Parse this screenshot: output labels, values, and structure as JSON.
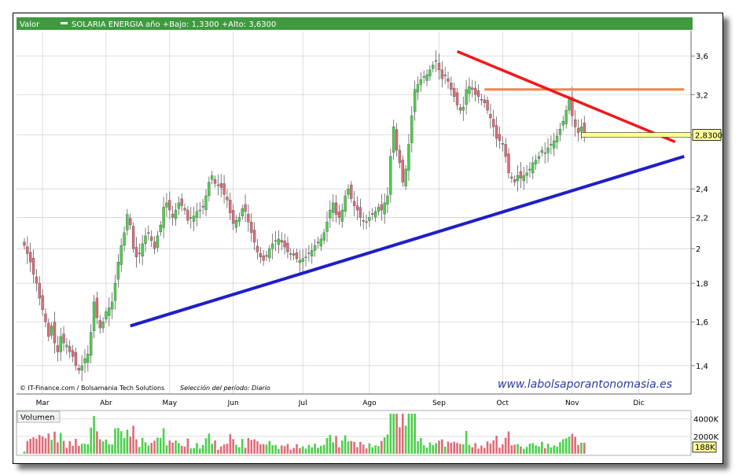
{
  "header": {
    "label": "Valor",
    "ticker": "SOLARIA ENERGIA",
    "range": "año +Bajo: 1,3300 +Alto: 3,6300"
  },
  "credits": {
    "source": "© IT-Finance.com / Bolsamania Tech Solutions",
    "period": "Selección del período: Diario"
  },
  "watermark": "www.labolsaporantonomasia.es",
  "last_price_badge": "2,8300",
  "volume_panel": {
    "label": "Volumen",
    "ticks": [
      {
        "v": 4000,
        "label": "4000K"
      },
      {
        "v": 2000,
        "label": "2000K"
      }
    ],
    "last_badge": "188K",
    "max": 4700
  },
  "colors": {
    "header_green": "#3f9a3f",
    "up": "#4cd04c",
    "down": "#e06b78",
    "grid": "#d3d3d3",
    "support_line": "#1f1fc8",
    "resistance_line": "#f0181c",
    "horizontal_level": "#f4834c",
    "badge_fill": "#ffff99",
    "watermark": "#2a3aa0"
  },
  "chart_data": {
    "type": "candlestick",
    "ylim": [
      1.29,
      3.87
    ],
    "y_scale": "log",
    "y_ticks": [
      {
        "v": 3.6,
        "label": "3,6"
      },
      {
        "v": 3.2,
        "label": "3,2"
      },
      {
        "v": 2.83,
        "label": ""
      },
      {
        "v": 2.4,
        "label": "2,4"
      },
      {
        "v": 2.2,
        "label": "2,2"
      },
      {
        "v": 2.0,
        "label": "2"
      },
      {
        "v": 1.8,
        "label": "1,8"
      },
      {
        "v": 1.6,
        "label": "1,6"
      },
      {
        "v": 1.4,
        "label": "1,4"
      }
    ],
    "months": [
      {
        "i": 6,
        "label": "Mar"
      },
      {
        "i": 27,
        "label": "Abr"
      },
      {
        "i": 48,
        "label": "May"
      },
      {
        "i": 69,
        "label": "Jun"
      },
      {
        "i": 92,
        "label": "Jul"
      },
      {
        "i": 114,
        "label": "Ago"
      },
      {
        "i": 137,
        "label": "Sep"
      },
      {
        "i": 158,
        "label": "Oct"
      },
      {
        "i": 181,
        "label": "Nov"
      },
      {
        "i": 203,
        "label": "Dic"
      }
    ],
    "closes": [
      2.02,
      1.97,
      1.92,
      1.85,
      1.8,
      1.72,
      1.66,
      1.6,
      1.53,
      1.58,
      1.5,
      1.46,
      1.53,
      1.5,
      1.49,
      1.46,
      1.44,
      1.4,
      1.38,
      1.4,
      1.43,
      1.45,
      1.55,
      1.7,
      1.62,
      1.57,
      1.6,
      1.65,
      1.67,
      1.7,
      1.8,
      1.92,
      2.02,
      2.1,
      2.22,
      2.15,
      2.0,
      1.95,
      1.97,
      2.03,
      2.08,
      2.1,
      2.05,
      2.0,
      2.08,
      2.15,
      2.27,
      2.3,
      2.25,
      2.2,
      2.25,
      2.3,
      2.28,
      2.25,
      2.18,
      2.2,
      2.21,
      2.24,
      2.25,
      2.27,
      2.35,
      2.45,
      2.5,
      2.44,
      2.43,
      2.41,
      2.36,
      2.32,
      2.23,
      2.16,
      2.18,
      2.2,
      2.26,
      2.24,
      2.17,
      2.1,
      2.04,
      1.98,
      1.95,
      1.93,
      1.96,
      2.0,
      2.03,
      2.05,
      2.06,
      2.04,
      2.01,
      1.98,
      1.97,
      1.96,
      1.94,
      1.93,
      1.94,
      1.95,
      1.97,
      1.99,
      2.02,
      2.04,
      2.06,
      2.1,
      2.17,
      2.25,
      2.3,
      2.22,
      2.2,
      2.25,
      2.35,
      2.4,
      2.33,
      2.28,
      2.25,
      2.2,
      2.18,
      2.17,
      2.2,
      2.22,
      2.24,
      2.27,
      2.25,
      2.3,
      2.35,
      2.65,
      2.9,
      2.7,
      2.6,
      2.45,
      2.55,
      2.75,
      3.0,
      3.25,
      3.3,
      3.35,
      3.38,
      3.4,
      3.45,
      3.5,
      3.55,
      3.45,
      3.36,
      3.4,
      3.33,
      3.25,
      3.18,
      3.1,
      3.05,
      3.08,
      3.25,
      3.28,
      3.25,
      3.2,
      3.18,
      3.15,
      3.12,
      3.05,
      2.98,
      2.9,
      2.8,
      2.78,
      2.75,
      2.65,
      2.52,
      2.48,
      2.45,
      2.5,
      2.48,
      2.5,
      2.52,
      2.55,
      2.6,
      2.62,
      2.65,
      2.7,
      2.68,
      2.72,
      2.75,
      2.78,
      2.82,
      2.88,
      2.95,
      3.05,
      3.15,
      3.0,
      2.9,
      2.85,
      2.9,
      2.83
    ],
    "annotations": {
      "support": {
        "from": [
          35,
          1.58
        ],
        "to": [
          218,
          2.65
        ]
      },
      "resistance": {
        "from": [
          143,
          3.65
        ],
        "to": [
          215,
          2.77
        ]
      },
      "level": {
        "from": [
          152,
          3.25
        ],
        "to": [
          218,
          3.25
        ]
      },
      "last_price": 2.83
    }
  }
}
